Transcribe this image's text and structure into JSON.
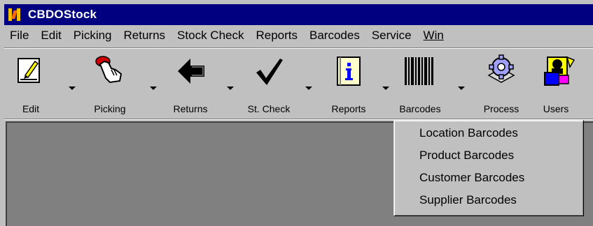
{
  "window": {
    "title": "CBDOStock"
  },
  "menu": [
    "File",
    "Edit",
    "Picking",
    "Returns",
    "Stock Check",
    "Reports",
    "Barcodes",
    "Service",
    "Win"
  ],
  "toolbar": {
    "buttons": [
      {
        "label": "Edit",
        "icon": "edit-icon",
        "has_dropdown": true
      },
      {
        "label": "Picking",
        "icon": "hand-pointer-icon",
        "has_dropdown": true
      },
      {
        "label": "Returns",
        "icon": "back-arrow-icon",
        "has_dropdown": true
      },
      {
        "label": "St. Check",
        "icon": "checkmark-icon",
        "has_dropdown": true
      },
      {
        "label": "Reports",
        "icon": "info-book-icon",
        "has_dropdown": true
      },
      {
        "label": "Barcodes",
        "icon": "barcode-icon",
        "has_dropdown": true
      },
      {
        "label": "Process",
        "icon": "gear-icon",
        "has_dropdown": false
      },
      {
        "label": "Users",
        "icon": "users-icon",
        "has_dropdown": false
      }
    ]
  },
  "barcodes_menu": {
    "items": [
      "Location Barcodes",
      "Product Barcodes",
      "Customer Barcodes",
      "Supplier Barcodes"
    ]
  },
  "colors": {
    "titlebar": "#000080",
    "face": "#c0c0c0",
    "client": "#808080",
    "reports_icon_blue": "#0000ff",
    "picking_icon_red": "#d00000"
  }
}
